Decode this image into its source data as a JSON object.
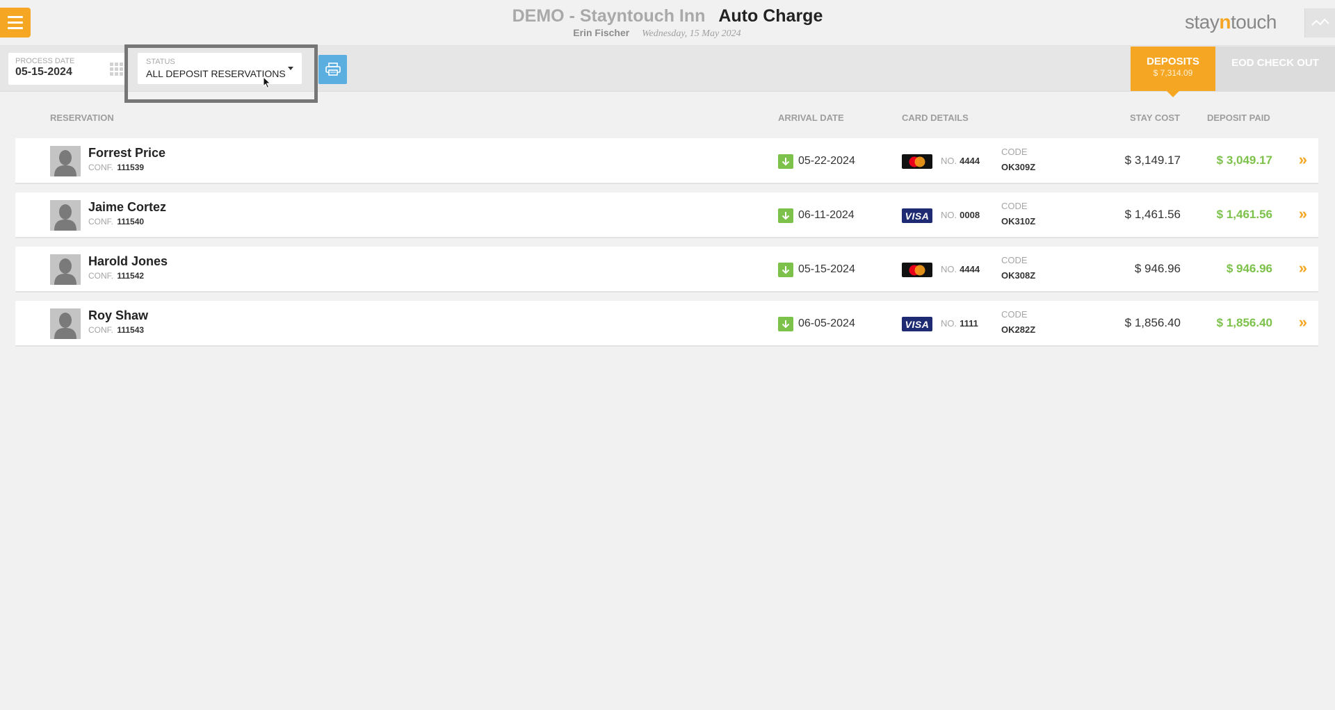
{
  "header": {
    "hotel_name": "DEMO - Stayntouch Inn",
    "page_title": "Auto Charge",
    "user_name": "Erin Fischer",
    "date": "Wednesday, 15 May 2024",
    "brand_prefix": "stay",
    "brand_n": "n",
    "brand_suffix": "touch"
  },
  "toolbar": {
    "process_date_label": "PROCESS DATE",
    "process_date_value": "05-15-2024",
    "status_label": "STATUS",
    "status_value": "ALL DEPOSIT RESERVATIONS"
  },
  "tabs": {
    "deposits_label": "DEPOSITS",
    "deposits_amount": "$ 7,314.09",
    "eod_label": "EOD CHECK OUT"
  },
  "columns": {
    "reservation": "RESERVATION",
    "arrival_date": "ARRIVAL DATE",
    "card_details": "CARD DETAILS",
    "stay_cost": "STAY COST",
    "deposit_paid": "DEPOSIT PAID"
  },
  "labels": {
    "conf": "CONF.",
    "no": "NO.",
    "code": "CODE",
    "visa": "VISA"
  },
  "colors": {
    "accent_orange": "#f5a623",
    "deposit_green": "#7cc14a",
    "print_blue": "#5aaee0",
    "visa_navy": "#1e2a72"
  },
  "reservations": [
    {
      "name": "Forrest Price",
      "conf": "111539",
      "arrival": "05-22-2024",
      "card_type": "mastercard",
      "card_no": "4444",
      "code": "OK309Z",
      "stay_cost": "$ 3,149.17",
      "deposit_paid": "$ 3,049.17"
    },
    {
      "name": "Jaime Cortez",
      "conf": "111540",
      "arrival": "06-11-2024",
      "card_type": "visa",
      "card_no": "0008",
      "code": "OK310Z",
      "stay_cost": "$ 1,461.56",
      "deposit_paid": "$ 1,461.56"
    },
    {
      "name": "Harold Jones",
      "conf": "111542",
      "arrival": "05-15-2024",
      "card_type": "mastercard",
      "card_no": "4444",
      "code": "OK308Z",
      "stay_cost": "$ 946.96",
      "deposit_paid": "$ 946.96"
    },
    {
      "name": "Roy Shaw",
      "conf": "111543",
      "arrival": "06-05-2024",
      "card_type": "visa",
      "card_no": "1111",
      "code": "OK282Z",
      "stay_cost": "$ 1,856.40",
      "deposit_paid": "$ 1,856.40"
    }
  ]
}
